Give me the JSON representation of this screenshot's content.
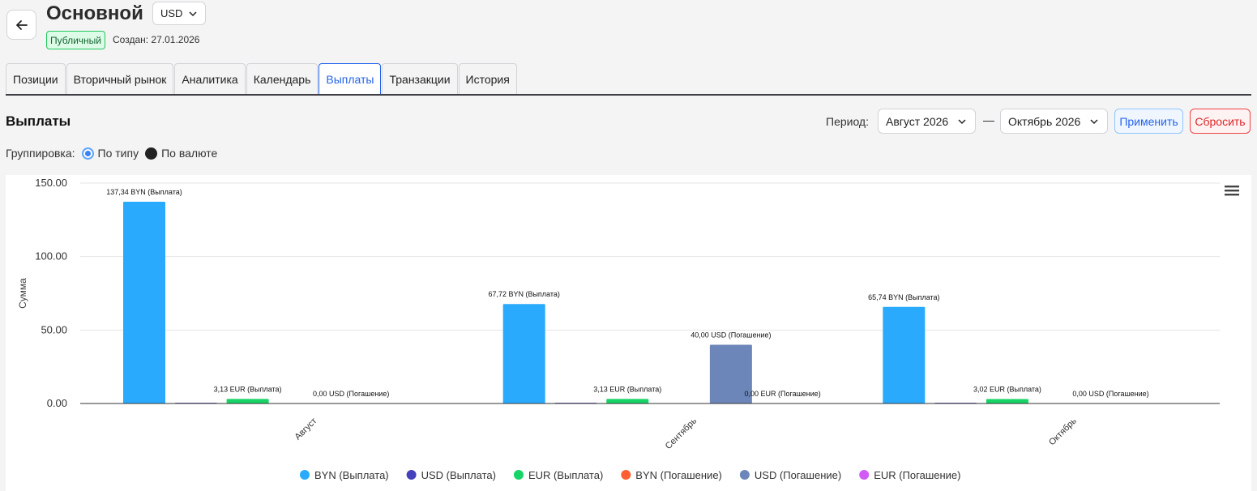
{
  "header": {
    "title": "Основной",
    "currency": "USD",
    "badge": "Публичный",
    "created": "Создан: 27.01.2026"
  },
  "tabs": [
    {
      "label": "Позиции",
      "active": false
    },
    {
      "label": "Вторичный рынок",
      "active": false
    },
    {
      "label": "Аналитика",
      "active": false
    },
    {
      "label": "Календарь",
      "active": false
    },
    {
      "label": "Выплаты",
      "active": true
    },
    {
      "label": "Транзакции",
      "active": false
    },
    {
      "label": "История",
      "active": false
    }
  ],
  "section": {
    "title": "Выплаты",
    "period_label": "Период:",
    "period_from": "Август 2026",
    "dash": "—",
    "period_to": "Октябрь 2026",
    "apply": "Применить",
    "reset": "Сбросить",
    "grouping_label": "Группировка:",
    "group_by_type": "По типу",
    "group_by_currency": "По валюте"
  },
  "colors": {
    "byn_payout": "#29aafd",
    "usd_payout": "#4540bc",
    "eur_payout": "#16d465",
    "byn_redemption": "#fd5e33",
    "usd_redemption": "#6c86b9",
    "eur_redemption": "#d05cf5"
  },
  "chart_data": {
    "type": "bar",
    "categories": [
      "Август",
      "Сентябрь",
      "Октябрь"
    ],
    "ylabel": "Сумма",
    "ylim": [
      0,
      150
    ],
    "yticks": [
      "0.00",
      "50.00",
      "100.00",
      "150.00"
    ],
    "legend_position": "bottom",
    "grid": true,
    "series": [
      {
        "name": "BYN (Выплата)",
        "color": "#29aafd",
        "values": [
          137.34,
          67.72,
          65.74
        ],
        "labels": [
          "137,34 BYN (Выплата)",
          "67,72 BYN (Выплата)",
          "65,74 BYN (Выплата)"
        ]
      },
      {
        "name": "USD (Выплата)",
        "color": "#4540bc",
        "values": [
          0.5,
          0.5,
          0.5
        ],
        "labels": [
          "",
          "",
          ""
        ]
      },
      {
        "name": "EUR (Выплата)",
        "color": "#16d465",
        "values": [
          3.13,
          3.13,
          3.02
        ],
        "labels": [
          "3,13 EUR (Выплата)",
          "3,13 EUR (Выплата)",
          "3,02 EUR (Выплата)"
        ]
      },
      {
        "name": "BYN (Погашение)",
        "color": "#fd5e33",
        "values": [
          0,
          0,
          0
        ],
        "labels": [
          "",
          "",
          ""
        ]
      },
      {
        "name": "USD (Погашение)",
        "color": "#6c86b9",
        "values": [
          0,
          40,
          0
        ],
        "labels": [
          "0,00 USD (Погашение)",
          "40,00 USD (Погашение)",
          "0,00 USD (Погашение)"
        ]
      },
      {
        "name": "EUR (Погашение)",
        "color": "#d05cf5",
        "values": [
          0,
          0,
          0
        ],
        "labels": [
          "",
          "0,00 EUR (Погашение)",
          ""
        ]
      }
    ]
  }
}
